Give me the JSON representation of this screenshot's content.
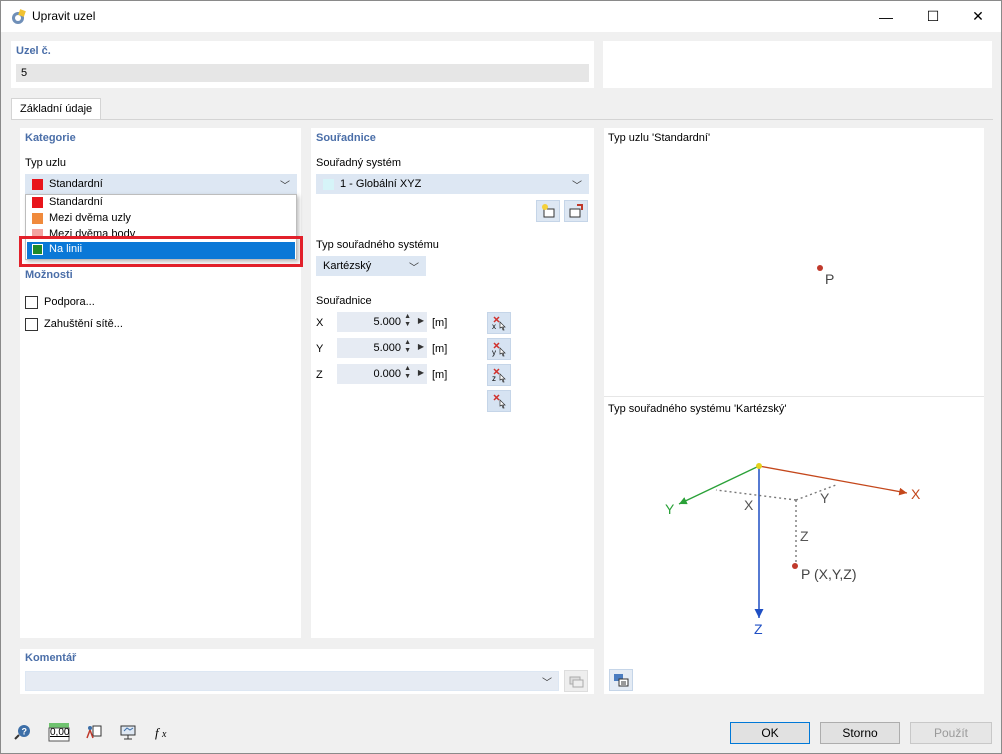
{
  "window": {
    "title": "Upravit uzel",
    "minimize_glyph": "—",
    "maximize_glyph": "☐",
    "close_glyph": "✕"
  },
  "node_number": {
    "label": "Uzel č.",
    "value": "5"
  },
  "tabs": [
    {
      "label": "Základní údaje"
    }
  ],
  "category": {
    "header": "Kategorie",
    "node_type_label": "Typ uzlu",
    "selected": "Standardní",
    "options": [
      {
        "label": "Standardní",
        "color": "#e8141b"
      },
      {
        "label": "Mezi dvěma uzly",
        "color": "#f08a3c"
      },
      {
        "label": "Mezi dvěma body",
        "color": "#f4a3a0"
      },
      {
        "label": "Na linii",
        "color": "#1f8a2a"
      }
    ],
    "selected_color": "#e8141b"
  },
  "options": {
    "header": "Možnosti",
    "support_label": "Podpora...",
    "mesh_label": "Zahuštění sítě..."
  },
  "coordinates": {
    "header": "Souřadnice",
    "system_label": "Souřadný systém",
    "system_value": "1 - Globální XYZ",
    "system_type_label": "Typ souřadného systému",
    "system_type_value": "Kartézský",
    "coords_label": "Souřadnice",
    "rows": [
      {
        "axis": "X",
        "value": "5.000",
        "unit": "[m]"
      },
      {
        "axis": "Y",
        "value": "5.000",
        "unit": "[m]"
      },
      {
        "axis": "Z",
        "value": "0.000",
        "unit": "[m]"
      }
    ]
  },
  "preview": {
    "node_type_caption": "Typ uzlu 'Standardní'",
    "point_label": "P",
    "system_caption": "Typ souřadného systému 'Kartézský'",
    "axis_x": "X",
    "axis_y": "Y",
    "axis_z": "Z",
    "point_xyz": "P (X,Y,Z)"
  },
  "comment": {
    "header": "Komentář",
    "value": ""
  },
  "buttons": {
    "ok": "OK",
    "cancel": "Storno",
    "apply": "Použít"
  },
  "toolbar": {
    "units_text": "0,00"
  },
  "colors": {
    "accent": "#4a6ea8",
    "selection": "#0a78d7",
    "highlight_box": "#e2202a"
  }
}
